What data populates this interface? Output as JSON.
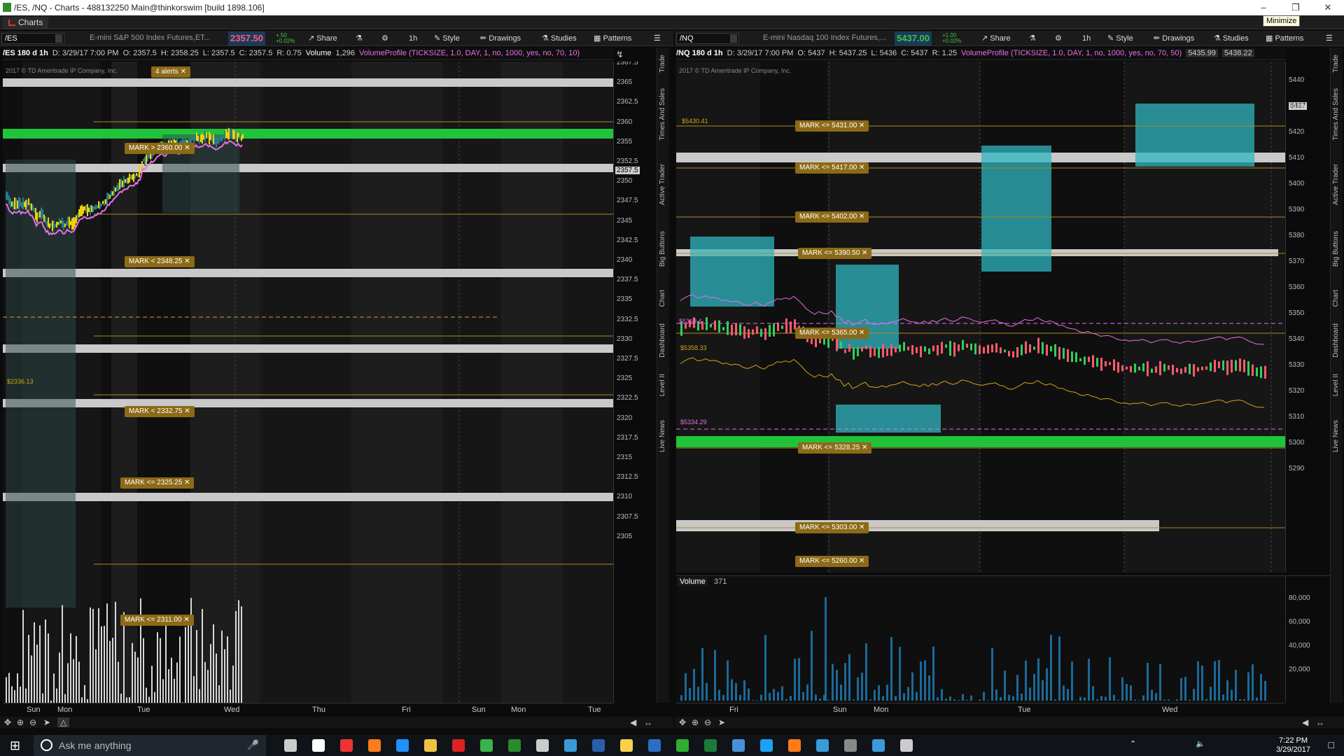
{
  "window": {
    "title": "/ES, /NQ - Charts - 488132250 Main@thinkorswim [build 1898.106]",
    "tooltip": "Minimize"
  },
  "tab": {
    "label": "Charts"
  },
  "left": {
    "symbol": "/ES",
    "description": "E-mini S&P 500 Index Futures,ET...",
    "price": "2357.50",
    "change_top": "+.50",
    "change_bottom": "+0.02%",
    "toolbar": {
      "timeframe": "1h",
      "style": "Style",
      "share": "Share",
      "drawings": "Drawings",
      "studies": "Studies",
      "patterns": "Patterns"
    },
    "info": {
      "label": "/ES 180 d 1h",
      "d": "D: 3/29/17 7:00 PM",
      "o": "O: 2357.5",
      "h": "H: 2358.25",
      "l": "L: 2357.5",
      "c": "C: 2357.5",
      "r": "R: 0.75",
      "vol_label": "Volume",
      "vol_val": "1,296",
      "study": "VolumeProfile (TICKSIZE, 1.0, DAY, 1, no, 1000, yes, no, 70, 10)"
    },
    "copyright": "2017 © TD Ameritrade IP Company, Inc.",
    "alerts_badge": "4 alerts",
    "alerts": [
      "MARK > 2360.00",
      "MARK < 2348.25",
      "MARK < 2332.75",
      "MARK <= 2325.25",
      "MARK <= 2311.00"
    ],
    "price_tag": "2357.5",
    "poc_label": "$2336.13",
    "y_ticks": [
      "2367.5",
      "2365",
      "2362.5",
      "2360",
      "2355",
      "2352.5",
      "2350",
      "2347.5",
      "2345",
      "2342.5",
      "2340",
      "2337.5",
      "2335",
      "2332.5",
      "2330",
      "2327.5",
      "2325",
      "2322.5",
      "2320",
      "2317.5",
      "2315",
      "2312.5",
      "2310",
      "2307.5",
      "2305"
    ],
    "x_labels": [
      "Sun",
      "Mon",
      "Tue",
      "Wed",
      "Thu",
      "Fri",
      "Sun",
      "Mon",
      "Tue"
    ]
  },
  "right": {
    "symbol": "/NQ",
    "description": "E-mini Nasdaq 100 Index Futures,...",
    "price": "5437.00",
    "change_top": "+1.00",
    "change_bottom": "+0.02%",
    "toolbar": {
      "timeframe": "1h",
      "style": "Style",
      "share": "Share",
      "drawings": "Drawings",
      "studies": "Studies",
      "patterns": "Patterns"
    },
    "info": {
      "label": "/NQ 180 d 1h",
      "d": "D: 3/29/17 7:00 PM",
      "o": "O: 5437",
      "h": "H: 5437.25",
      "l": "L: 5436",
      "c": "C: 5437",
      "r": "R: 1.25",
      "study": "VolumeProfile (TICKSIZE, 1.0, DAY, 1, no, 1000, yes, no, 70, 50)",
      "v1": "5435.99",
      "v2": "5438.22"
    },
    "copyright": "2017 © TD Ameritrade IP Company, Inc.",
    "alerts": [
      "MARK <= 5431.00",
      "MARK <= 5417.00",
      "MARK <= 5402.00",
      "MARK <= 5390.50",
      "MARK <= 5365.00",
      "MARK <= 5328.25",
      "MARK <= 5303.00",
      "MARK <= 5260.00"
    ],
    "price_tag": "5437",
    "level_labels": [
      "$5430.41",
      "$5369.4",
      "$5358.33",
      "$5334.29"
    ],
    "y_ticks": [
      "5450",
      "5440",
      "5430",
      "5420",
      "5410",
      "5400",
      "5390",
      "5380",
      "5370",
      "5360",
      "5350",
      "5340",
      "5330",
      "5320",
      "5310",
      "5300",
      "5290"
    ],
    "volume_label": "Volume",
    "volume_value": "371",
    "vol_ticks": [
      "80,000",
      "60,000",
      "40,000",
      "20,000"
    ],
    "x_labels": [
      "Fri",
      "Sun",
      "Mon",
      "Tue",
      "Wed"
    ]
  },
  "side_tabs": [
    "Trade",
    "Times And Sales",
    "Active Trader",
    "Big Buttons",
    "Chart",
    "Dashboard",
    "Level II",
    "Live News"
  ],
  "taskbar": {
    "search_placeholder": "Ask me anything",
    "time": "7:22 PM",
    "date": "3/29/2017"
  }
}
